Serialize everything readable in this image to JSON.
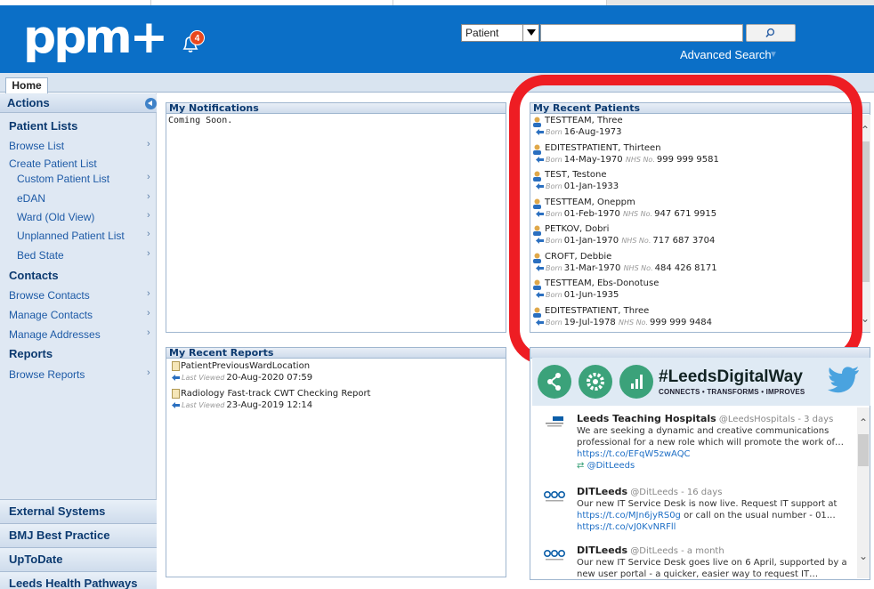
{
  "header": {
    "logo": "ppm+",
    "notification_count": "4",
    "search_type": "Patient",
    "search_value": "",
    "advanced_search": "Advanced Search"
  },
  "tabs": [
    {
      "label": "Home"
    }
  ],
  "sidebar": {
    "actions_label": "Actions",
    "sections": [
      {
        "heading": "Patient Lists"
      },
      {
        "heading": "Contacts"
      },
      {
        "heading": "Reports"
      }
    ],
    "items": [
      {
        "label": "Browse List"
      },
      {
        "label": "Create Patient List"
      },
      {
        "label": "Custom Patient List"
      },
      {
        "label": "eDAN"
      },
      {
        "label": "Ward (Old View)"
      },
      {
        "label": "Unplanned Patient List"
      },
      {
        "label": "Bed State"
      },
      {
        "label": "Browse Contacts"
      },
      {
        "label": "Manage Contacts"
      },
      {
        "label": "Manage Addresses"
      },
      {
        "label": "Browse Reports"
      }
    ],
    "bottom_links": [
      {
        "label": "External Systems"
      },
      {
        "label": "BMJ Best Practice"
      },
      {
        "label": "UpToDate"
      },
      {
        "label": "Leeds Health Pathways"
      }
    ]
  },
  "notifications": {
    "title": "My Notifications",
    "body": "Coming Soon."
  },
  "recent_patients": {
    "title": "My Recent Patients",
    "born_label": "Born",
    "nhs_label": "NHS No.",
    "patients": [
      {
        "name": "TESTTEAM, Three",
        "born": "16-Aug-1973",
        "nhs": ""
      },
      {
        "name": "EDITESTPATIENT, Thirteen",
        "born": "14-May-1970",
        "nhs": "999 999 9581"
      },
      {
        "name": "TEST, Testone",
        "born": "01-Jan-1933",
        "nhs": ""
      },
      {
        "name": "TESTTEAM, Oneppm",
        "born": "01-Feb-1970",
        "nhs": "947 671 9915"
      },
      {
        "name": "PETKOV, Dobri",
        "born": "01-Jan-1970",
        "nhs": "717 687 3704"
      },
      {
        "name": "CROFT, Debbie",
        "born": "31-Mar-1970",
        "nhs": "484 426 8171"
      },
      {
        "name": "TESTTEAM, Ebs-Donotuse",
        "born": "01-Jun-1935",
        "nhs": ""
      },
      {
        "name": "EDITESTPATIENT, Three",
        "born": "19-Jul-1978",
        "nhs": "999 999 9484"
      }
    ]
  },
  "recent_reports": {
    "title": "My Recent Reports",
    "last_viewed_label": "Last Viewed",
    "reports": [
      {
        "name": "PatientPreviousWardLocation",
        "last_viewed": "20-Aug-2020 07:59"
      },
      {
        "name": "Radiology Fast-track CWT Checking Report",
        "last_viewed": "23-Aug-2019 12:14"
      }
    ]
  },
  "social": {
    "hashtag": "#LeedsDigitalWay",
    "tagline": "CONNECTS • TRANSFORMS • IMPROVES",
    "tweets": [
      {
        "author": "Leeds Teaching Hospitals",
        "handle": "@LeedsHospitals - 3 days",
        "text": "We are seeking a dynamic and creative communications professional for a new role which will promote the work of…",
        "link": "https://t.co/EFqW5zwAQC",
        "retweet_by": "@DitLeeds"
      },
      {
        "author": "DITLeeds",
        "handle": "@DitLeeds - 16 days",
        "text_before": "Our new IT Service Desk is now live. Request IT support at",
        "link1": "https://t.co/MJn6jyRS0g",
        "text_mid": "or call on the usual number - 01…",
        "link2": "https://t.co/vJ0KvNRFll"
      },
      {
        "author": "DITLeeds",
        "handle": "@DitLeeds - a month",
        "text": "Our new IT Service Desk goes live on 6 April, supported by a new user portal - a quicker, easier way to request IT…"
      }
    ]
  },
  "colors": {
    "header_blue": "#0b6fc7",
    "highlight_red": "#ee1d23",
    "social_green": "#3ba27a",
    "twitter_blue": "#4aa3df"
  }
}
